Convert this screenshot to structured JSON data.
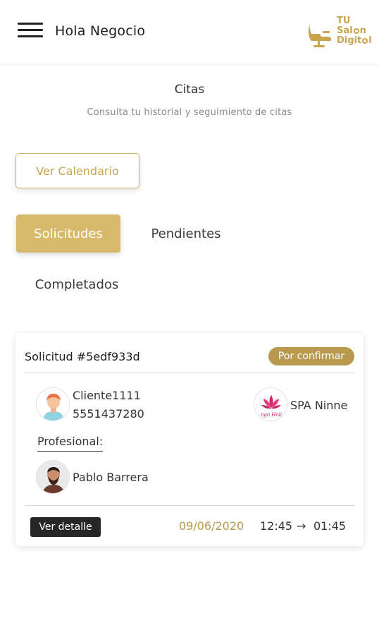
{
  "header": {
    "greeting": "Hola Negocio",
    "menu_icon": "hamburger-menu-icon"
  },
  "logo": {
    "line1": "TU",
    "line2": "Sal",
    "line2b": "n",
    "line3": "Digit",
    "line3b": "l",
    "icon": "salon-chair-icon"
  },
  "page": {
    "title": "Citas",
    "subtitle": "Consulta tu historial y seguimiento de citas"
  },
  "calendar_button": "Ver Calendario",
  "tabs": [
    {
      "label": "Solicitudes",
      "active": true
    },
    {
      "label": "Pendientes"
    },
    {
      "label": "Completados"
    }
  ],
  "card": {
    "title": "Solicitud #5edf933d",
    "status": "Por confirmar",
    "client": {
      "name": "Cliente1111",
      "phone": "5551437280"
    },
    "business": {
      "name": "SPA Ninne",
      "logo_text": "ngo Holi"
    },
    "professional_label": "Profesional:",
    "professional_name": "Pablo Barrera",
    "detail_button": "Ver detalle",
    "date": "09/06/2020",
    "start": "12:45",
    "arrow": "→",
    "end": "01:45"
  },
  "colors": {
    "gold": "#d6b96a",
    "gold_text": "#c9a44e",
    "badge": "#b9994d",
    "dark": "#262626"
  }
}
